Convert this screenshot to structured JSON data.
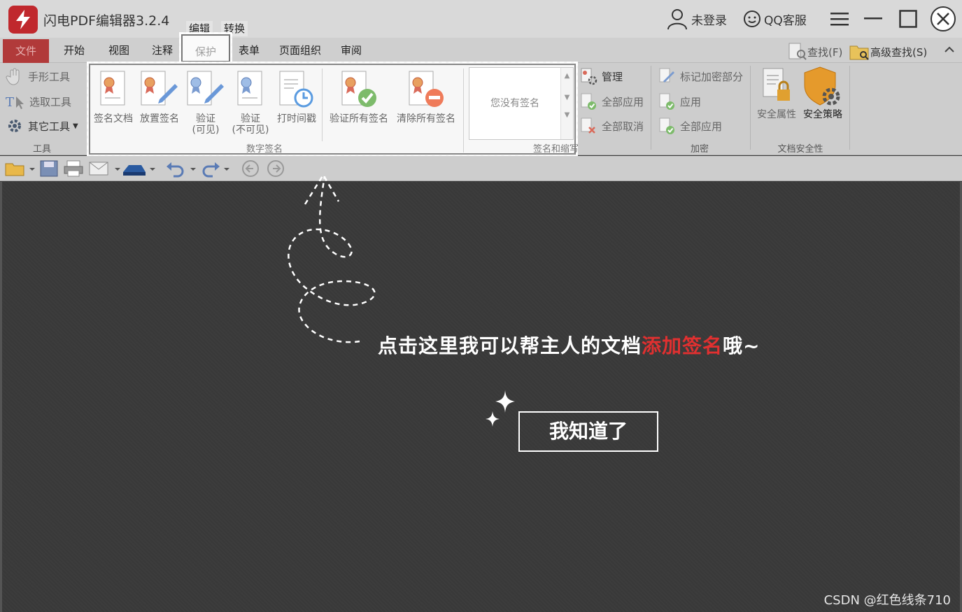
{
  "app": {
    "title": "闪电PDF编辑器3.2.4"
  },
  "top_tabs": {
    "edit": "编辑",
    "convert": "转换"
  },
  "header": {
    "login": "未登录",
    "support": "QQ客服"
  },
  "ribbon_tabs": [
    "文件",
    "开始",
    "视图",
    "注释",
    "保护",
    "表单",
    "页面组织",
    "审阅"
  ],
  "search": {
    "find": "查找(F)",
    "advanced": "高级查找(S)"
  },
  "tools_group": {
    "hand": "手形工具",
    "select": "选取工具",
    "other": "其它工具",
    "label": "工具"
  },
  "digital_signature": {
    "sign_doc": "签名文档",
    "place_sig": "放置签名",
    "verify_visible_1": "验证",
    "verify_visible_2": "(可见)",
    "verify_invisible_1": "验证",
    "verify_invisible_2": "(不可见)",
    "timestamp": "打时间戳",
    "verify_all": "验证所有签名",
    "clear_all": "清除所有签名",
    "label": "数字签名",
    "no_signature": "您没有签名",
    "sign_label": "签名和缩写"
  },
  "manage_group": {
    "manage": "管理",
    "apply_all": "全部应用",
    "cancel_all": "全部取消"
  },
  "encrypt_group": {
    "mark": "标记加密部分",
    "apply": "应用",
    "apply_all": "全部应用",
    "label": "加密"
  },
  "security_group": {
    "properties": "安全属性",
    "policy": "安全策略",
    "label": "文档安全性"
  },
  "tip": {
    "text_before": "点击这里我可以帮主人的文档",
    "text_highlight": "添加签名",
    "text_after": "哦~",
    "button": "我知道了"
  },
  "watermark": "CSDN @红色线条710",
  "colors": {
    "brand": "#c0282d",
    "highlight": "#e03030"
  }
}
